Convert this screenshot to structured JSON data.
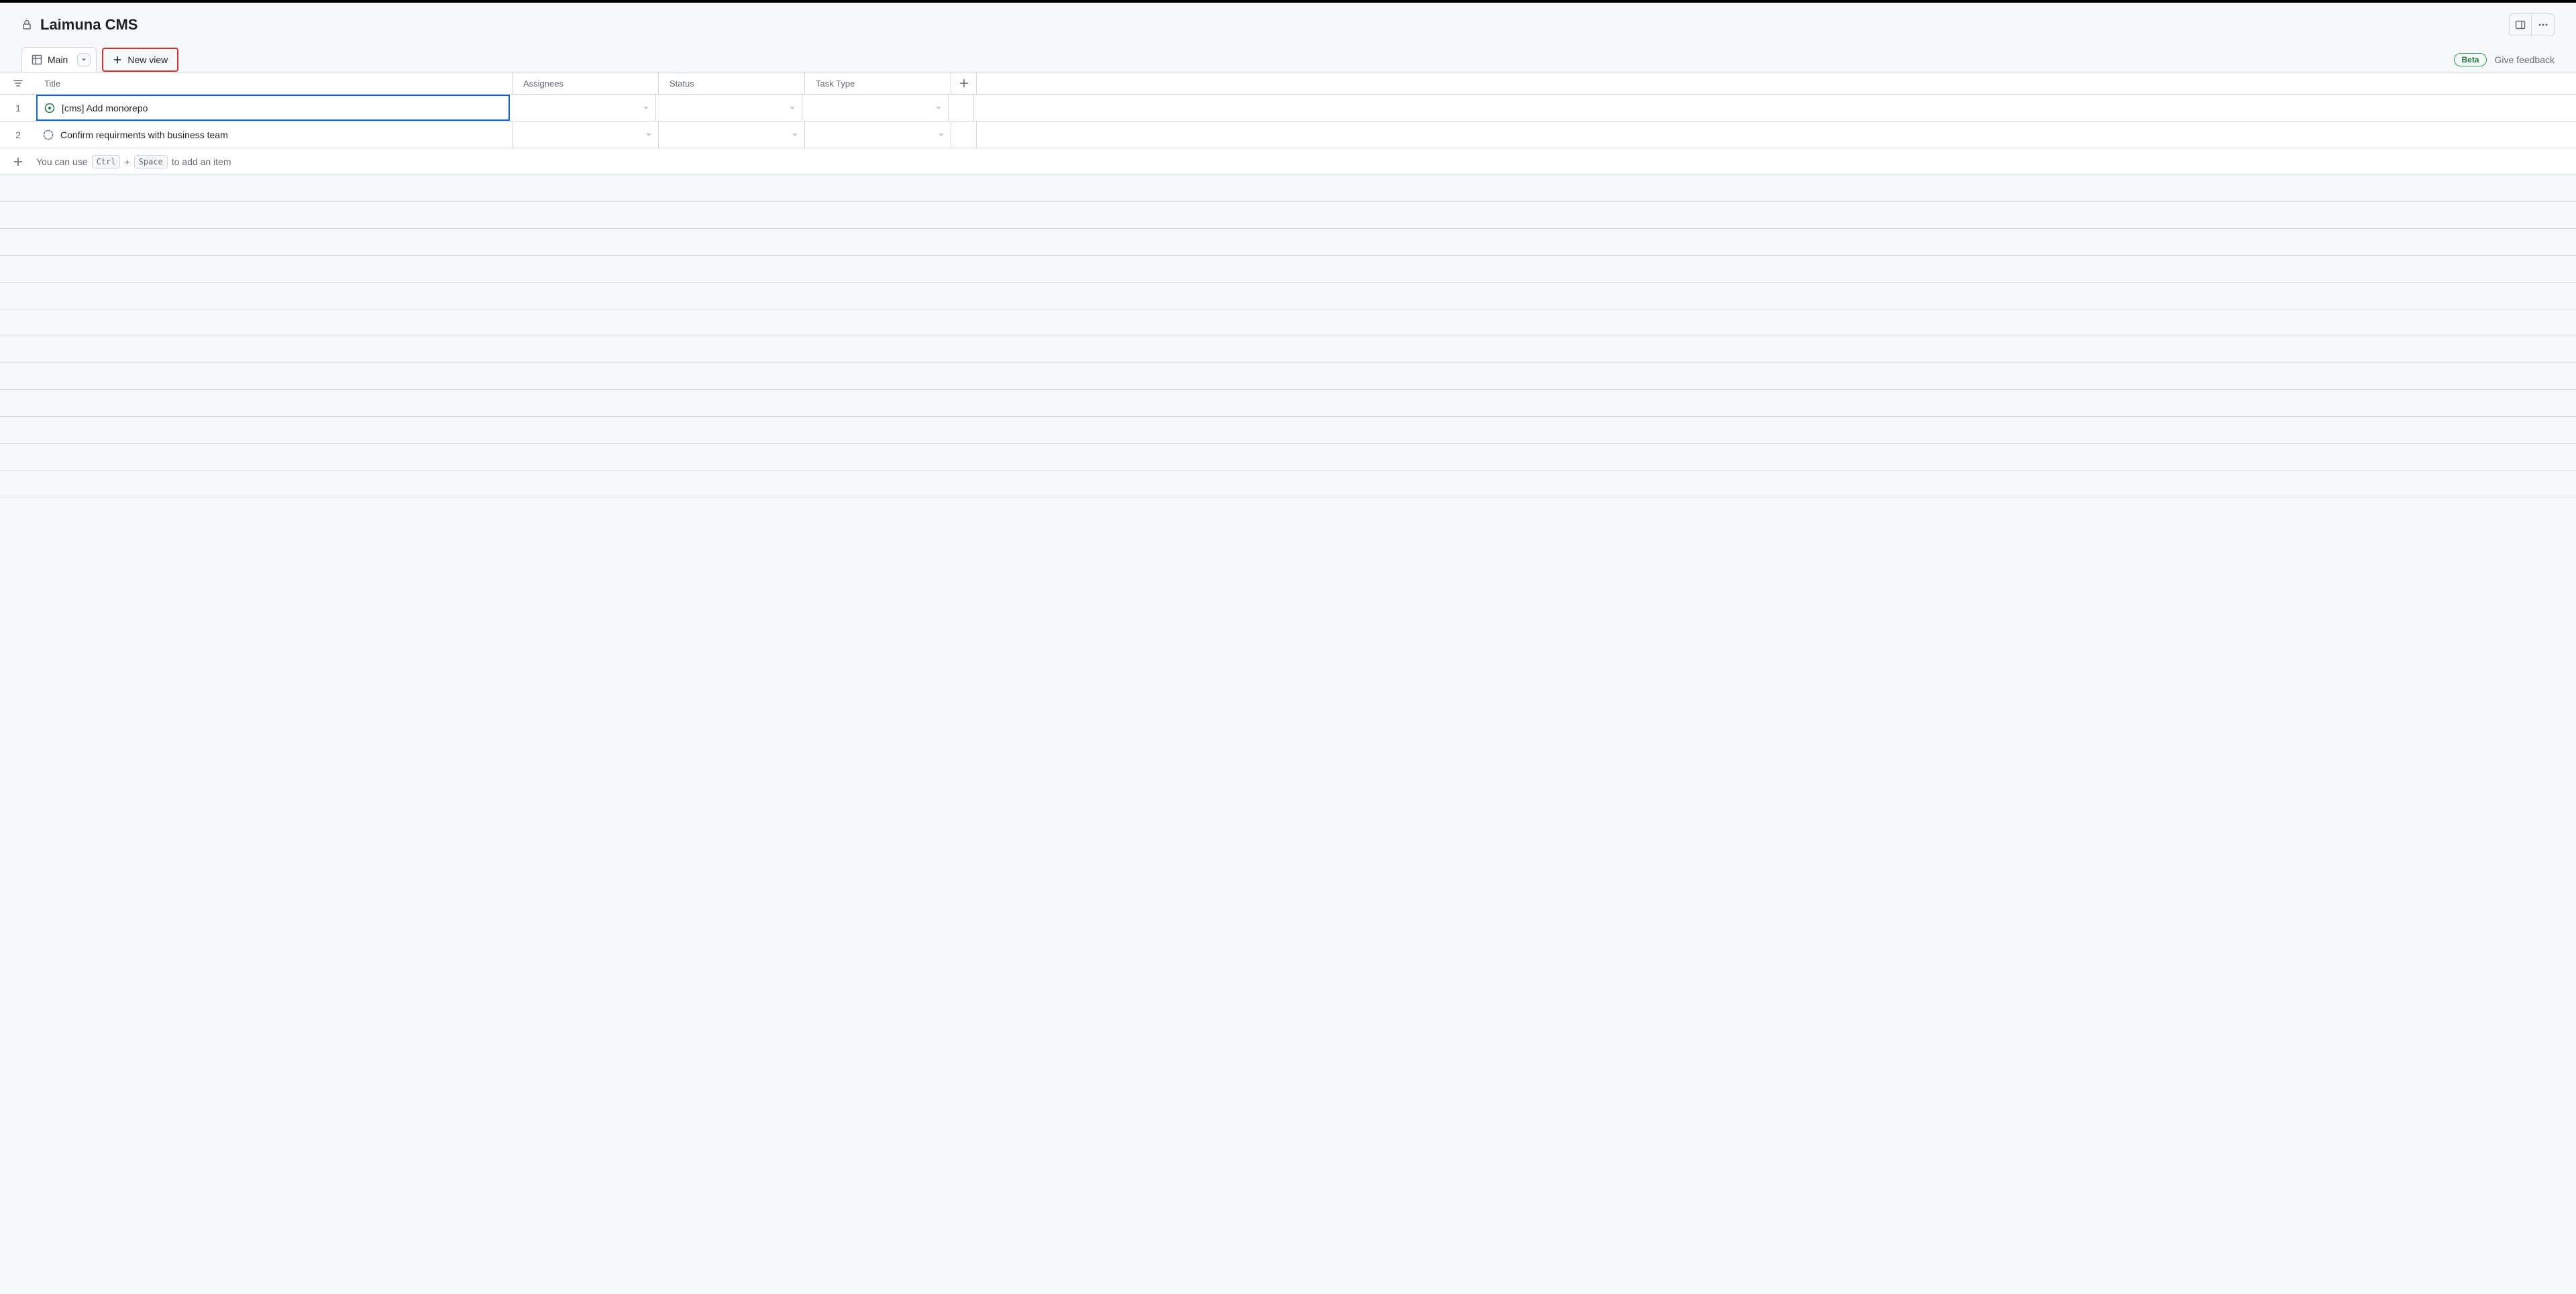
{
  "project_title": "Laimuna CMS",
  "tabs": {
    "main_label": "Main",
    "new_view_label": "New view"
  },
  "header_right": {
    "beta_label": "Beta",
    "feedback_label": "Give feedback"
  },
  "columns": {
    "title": "Title",
    "assignees": "Assignees",
    "status": "Status",
    "task_type": "Task Type"
  },
  "rows": [
    {
      "num": "1",
      "title": "[cms] Add monorepo",
      "type": "issue"
    },
    {
      "num": "2",
      "title": "Confirm requirments with business team",
      "type": "draft"
    }
  ],
  "add_item": {
    "prefix": "You can use",
    "key1": "Ctrl",
    "plus": "+",
    "key2": "Space",
    "suffix": "to add an item"
  }
}
